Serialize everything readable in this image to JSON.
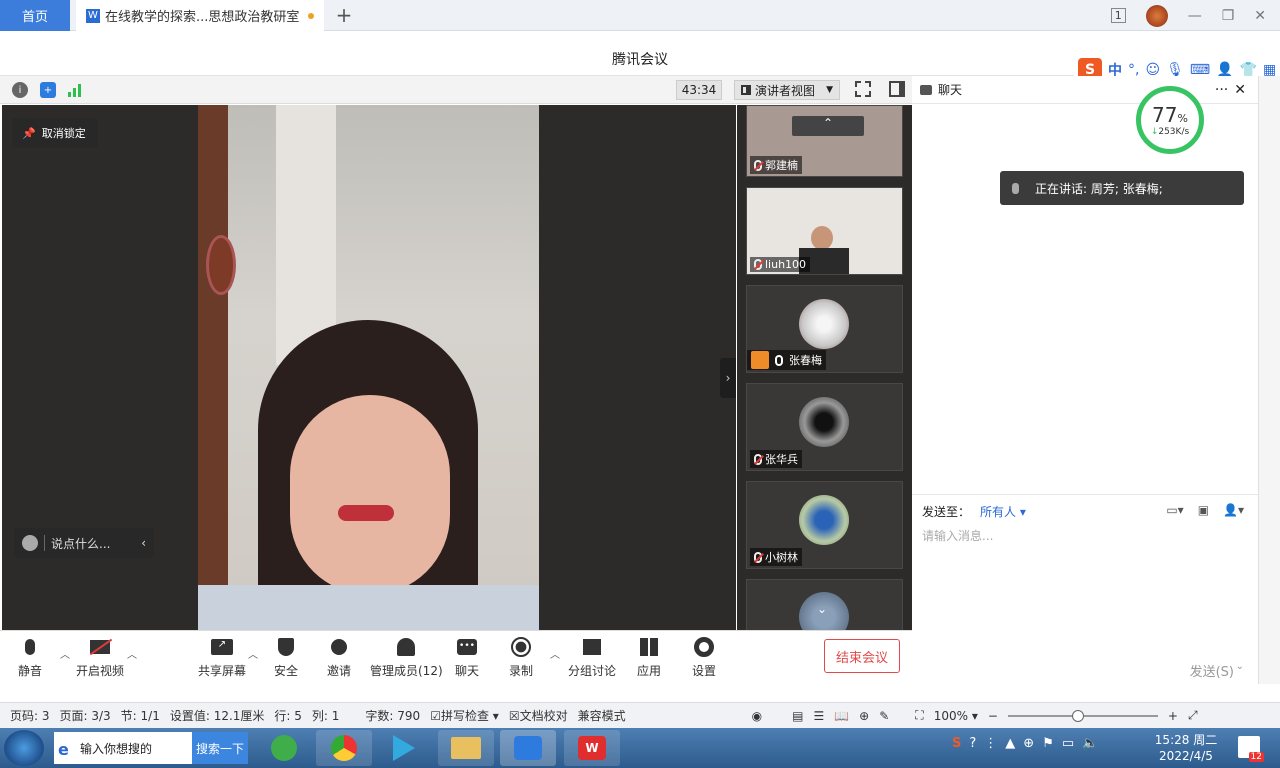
{
  "browser": {
    "home_tab": "首页",
    "doc_tab": "在线教学的探索...思想政治教研室",
    "doc_icon": "W",
    "new_tab": "+"
  },
  "meeting": {
    "title": "腾讯会议",
    "timer": "43:34",
    "view_mode": "演讲者视图",
    "unlock_label": "取消锁定",
    "say_placeholder": "说点什么...",
    "participants": [
      {
        "name": "郭建楠",
        "muted": true
      },
      {
        "name": "liuh100",
        "muted": true
      },
      {
        "name": "张春梅",
        "muted": false
      },
      {
        "name": "张华兵",
        "muted": true
      },
      {
        "name": "小树林",
        "muted": true
      }
    ],
    "controls": {
      "mute": "静音",
      "video": "开启视频",
      "share": "共享屏幕",
      "security": "安全",
      "invite": "邀请",
      "members": "管理成员(12)",
      "chat": "聊天",
      "record": "录制",
      "breakout": "分组讨论",
      "apps": "应用",
      "settings": "设置",
      "end": "结束会议"
    }
  },
  "chat": {
    "title": "聊天",
    "speaking": "正在讲话: 周芳; 张春梅;",
    "send_to_label": "发送至：",
    "send_to_value": "所有人",
    "input_placeholder": "请输入消息...",
    "send_button": "发送(S)"
  },
  "netspeed": {
    "percent": "77",
    "unit": "%",
    "speed": "253K/s"
  },
  "ime": {
    "mode": "中"
  },
  "statusbar": {
    "page_code": "页码: 3",
    "page": "页面: 3/3",
    "section": "节: 1/1",
    "setting": "设置值: 12.1厘米",
    "row": "行: 5",
    "col": "列: 1",
    "wordcount": "字数: 790",
    "spellcheck": "拼写检查",
    "proofread": "文档校对",
    "compat": "兼容模式",
    "zoom": "100%"
  },
  "taskbar": {
    "search_placeholder": "输入你想搜的",
    "search_button": "搜索一下",
    "time": "15:28 周二",
    "date": "2022/4/5",
    "notif_count": "12"
  },
  "colors": {
    "accent": "#3c7ddb",
    "end_red": "#e04a4a",
    "gauge_green": "#39c463",
    "video_bg": "#2d2b29"
  }
}
